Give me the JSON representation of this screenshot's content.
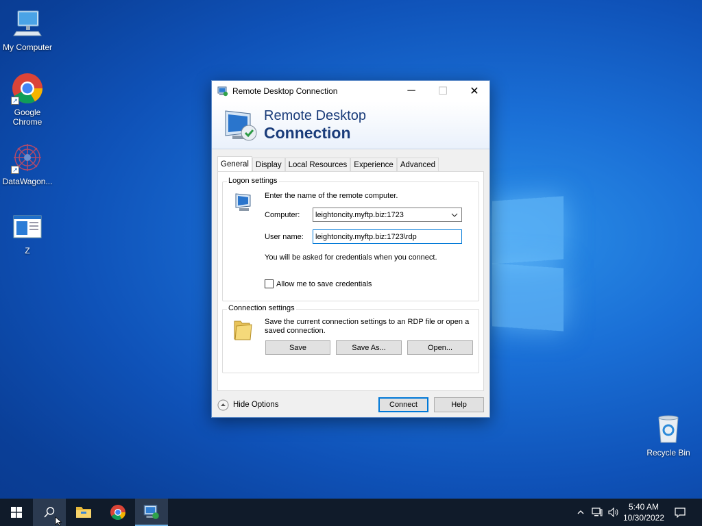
{
  "desktop": {
    "icons": [
      {
        "label": "My Computer"
      },
      {
        "label": "Google Chrome"
      },
      {
        "label": "DataWagon..."
      },
      {
        "label": "Z"
      },
      {
        "label": "Recycle Bin"
      }
    ]
  },
  "dialog": {
    "title": "Remote Desktop Connection",
    "banner": {
      "line1": "Remote Desktop",
      "line2": "Connection"
    },
    "window_controls": {
      "minimize": "─",
      "maximize": "☐",
      "close": "✕"
    },
    "tabs": [
      {
        "label": "General",
        "active": true
      },
      {
        "label": "Display"
      },
      {
        "label": "Local Resources"
      },
      {
        "label": "Experience"
      },
      {
        "label": "Advanced"
      }
    ],
    "logon": {
      "legend": "Logon settings",
      "instruction": "Enter the name of the remote computer.",
      "computer_label": "Computer:",
      "computer_value": "leightoncity.myftp.biz:1723",
      "username_label": "User name:",
      "username_value": "leightoncity.myftp.biz:1723\\rdp",
      "credentials_note": "You will be asked for credentials when you connect.",
      "save_credentials_label": "Allow me to save credentials",
      "save_credentials_checked": false
    },
    "connection": {
      "legend": "Connection settings",
      "description": "Save the current connection settings to an RDP file or open a saved connection.",
      "save": "Save",
      "save_as": "Save As...",
      "open": "Open..."
    },
    "footer": {
      "hide_options": "Hide Options",
      "connect": "Connect",
      "help": "Help"
    }
  },
  "taskbar": {
    "clock_time": "5:40 AM",
    "clock_date": "10/30/2022"
  },
  "colors": {
    "accent": "#0078d7",
    "banner_text": "#1a3c7a",
    "taskbar": "#101b2a"
  }
}
